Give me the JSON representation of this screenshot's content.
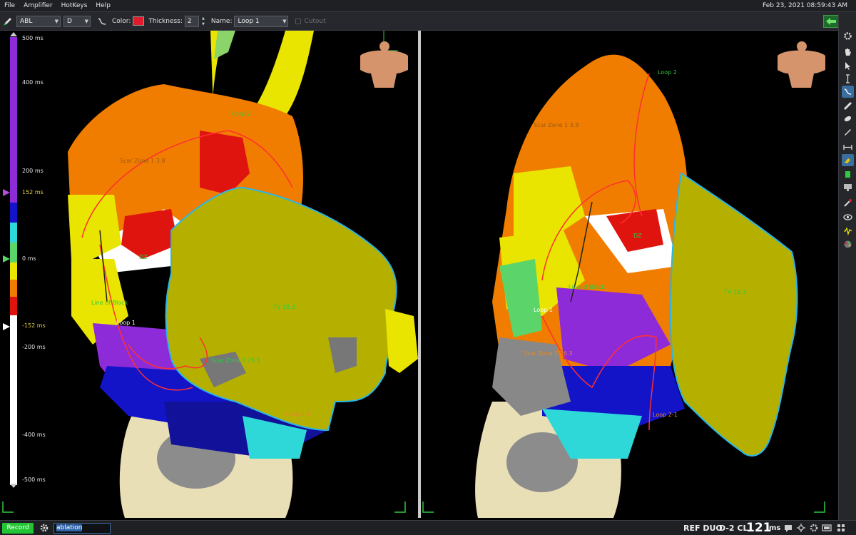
{
  "menu": {
    "items": [
      "File",
      "Amplifier",
      "HotKeys",
      "Help"
    ],
    "datetime": "Feb 23, 2021 08:59:43 AM"
  },
  "toolbar": {
    "catheter_value": "ABL",
    "channel_value": "D",
    "color_label": "Color:",
    "color_value": "#e21b2c",
    "thickness_label": "Thickness:",
    "thickness_value": "2",
    "name_label": "Name:",
    "name_value": "Loop 1",
    "cutout_label": "Cutout"
  },
  "scale": {
    "labels": [
      "500 ms",
      "400 ms",
      "200 ms",
      "152 ms",
      "0 ms",
      "-152 ms",
      "-200 ms",
      "-400 ms",
      "-500 ms"
    ]
  },
  "left_view": {
    "annotations": [
      "Loop 2",
      "Scar Zone 1 3.8",
      "DZ",
      "Line of Block",
      "Loop 1",
      "TV 18.3",
      "Scar Zone 2 26.3",
      "Loop 2-1"
    ]
  },
  "right_view": {
    "annotations": [
      "Loop 2",
      "Scar Zone 1 3.8",
      "DZ",
      "Line of Block",
      "Loop 1",
      "TV 18.3",
      "Scar Zone 2 26.3",
      "Loop 2-1"
    ]
  },
  "bottombar": {
    "record_label": "Record",
    "input_value": "ablation",
    "status_text": "REF DUO",
    "cl_label": "D-2 CL",
    "cl_value": "121",
    "cl_unit": "ms"
  },
  "colors": {
    "accent": "#3a6e9e",
    "record": "#22c533",
    "annotation_green": "#2ecc40",
    "annotation_orange": "#e08a2c",
    "outline_cyan": "#29b6e8"
  }
}
